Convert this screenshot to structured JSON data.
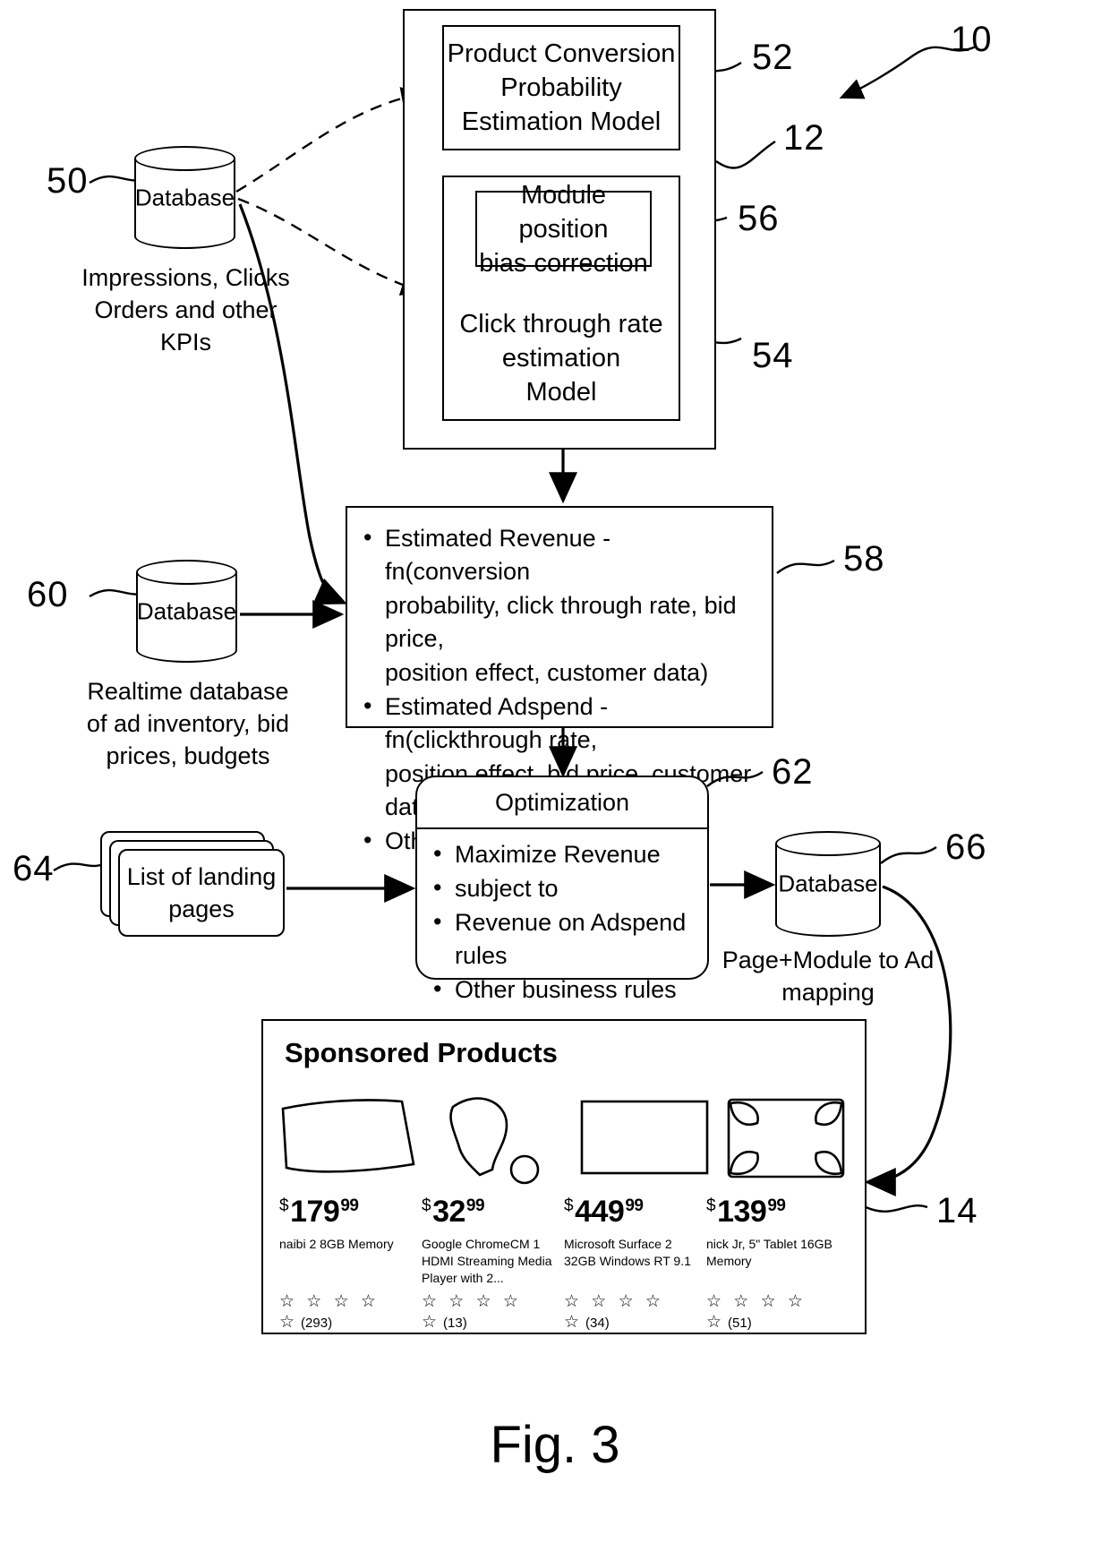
{
  "figure": {
    "caption": "Fig. 3"
  },
  "reference_numerals": {
    "system": "10",
    "models_container": "12",
    "sponsored_module": "14",
    "kpi_database": "50",
    "conversion_model": "52",
    "ctr_model": "54",
    "bias_correction": "56",
    "estimates_box": "58",
    "realtime_database": "60",
    "optimization": "62",
    "landing_pages": "64",
    "mapping_database": "66"
  },
  "kpi_database": {
    "cylinder_label": "Database",
    "caption_line1": "Impressions, Clicks",
    "caption_line2": "Orders and other",
    "caption_line3": "KPIs"
  },
  "realtime_database": {
    "cylinder_label": "Database",
    "caption_line1": "Realtime database",
    "caption_line2": "of ad inventory, bid",
    "caption_line3": "prices, budgets"
  },
  "mapping_database": {
    "cylinder_label": "Database",
    "caption_line1": "Page+Module to Ad",
    "caption_line2": "mapping"
  },
  "conversion_model": {
    "line1": "Product Conversion",
    "line2": "Probability",
    "line3": "Estimation Model"
  },
  "bias_correction": {
    "line1": "Module position",
    "line2": "bias correction"
  },
  "ctr_model": {
    "line1": "Click through rate",
    "line2": "estimation",
    "line3": "Model"
  },
  "estimates_box": {
    "items": [
      {
        "bullet": true,
        "text": "Estimated Revenue - fn(conversion"
      },
      {
        "bullet": false,
        "text": "probability, click through rate, bid price,"
      },
      {
        "bullet": false,
        "text": "position effect, customer data)"
      },
      {
        "bullet": true,
        "text": "Estimated Adspend - fn(clickthrough rate,"
      },
      {
        "bullet": false,
        "text": "position effect, bid price, customer data)"
      },
      {
        "bullet": true,
        "text": "Other relevant data"
      }
    ]
  },
  "optimization": {
    "header": "Optimization",
    "items": [
      "Maximize Revenue",
      "subject to",
      "Revenue on Adspend rules",
      "Other business rules"
    ]
  },
  "landing_pages": {
    "line1": "List of landing",
    "line2": "pages"
  },
  "sponsored_products": {
    "title": "Sponsored Products",
    "star_glyphs": "☆ ☆ ☆ ☆ ☆",
    "products": [
      {
        "currency": "$",
        "dollars": "179",
        "cents": "99",
        "description": "naibi 2 8GB Memory",
        "reviews": "(293)",
        "thumb": "blob-rounded-rect"
      },
      {
        "currency": "$",
        "dollars": "32",
        "cents": "99",
        "description": "Google ChromeCM 1 HDMI Streaming Media Player with 2...",
        "reviews": "(13)",
        "thumb": "blob-teardrop"
      },
      {
        "currency": "$",
        "dollars": "449",
        "cents": "99",
        "description": "Microsoft Surface 2 32GB Windows RT 9.1",
        "reviews": "(34)",
        "thumb": "rectangle"
      },
      {
        "currency": "$",
        "dollars": "139",
        "cents": "99",
        "description": "nick Jr, 5\" Tablet 16GB Memory",
        "reviews": "(51)",
        "thumb": "rounded-corners"
      }
    ]
  },
  "colors": {
    "ink": "#000000",
    "paper": "#ffffff"
  }
}
